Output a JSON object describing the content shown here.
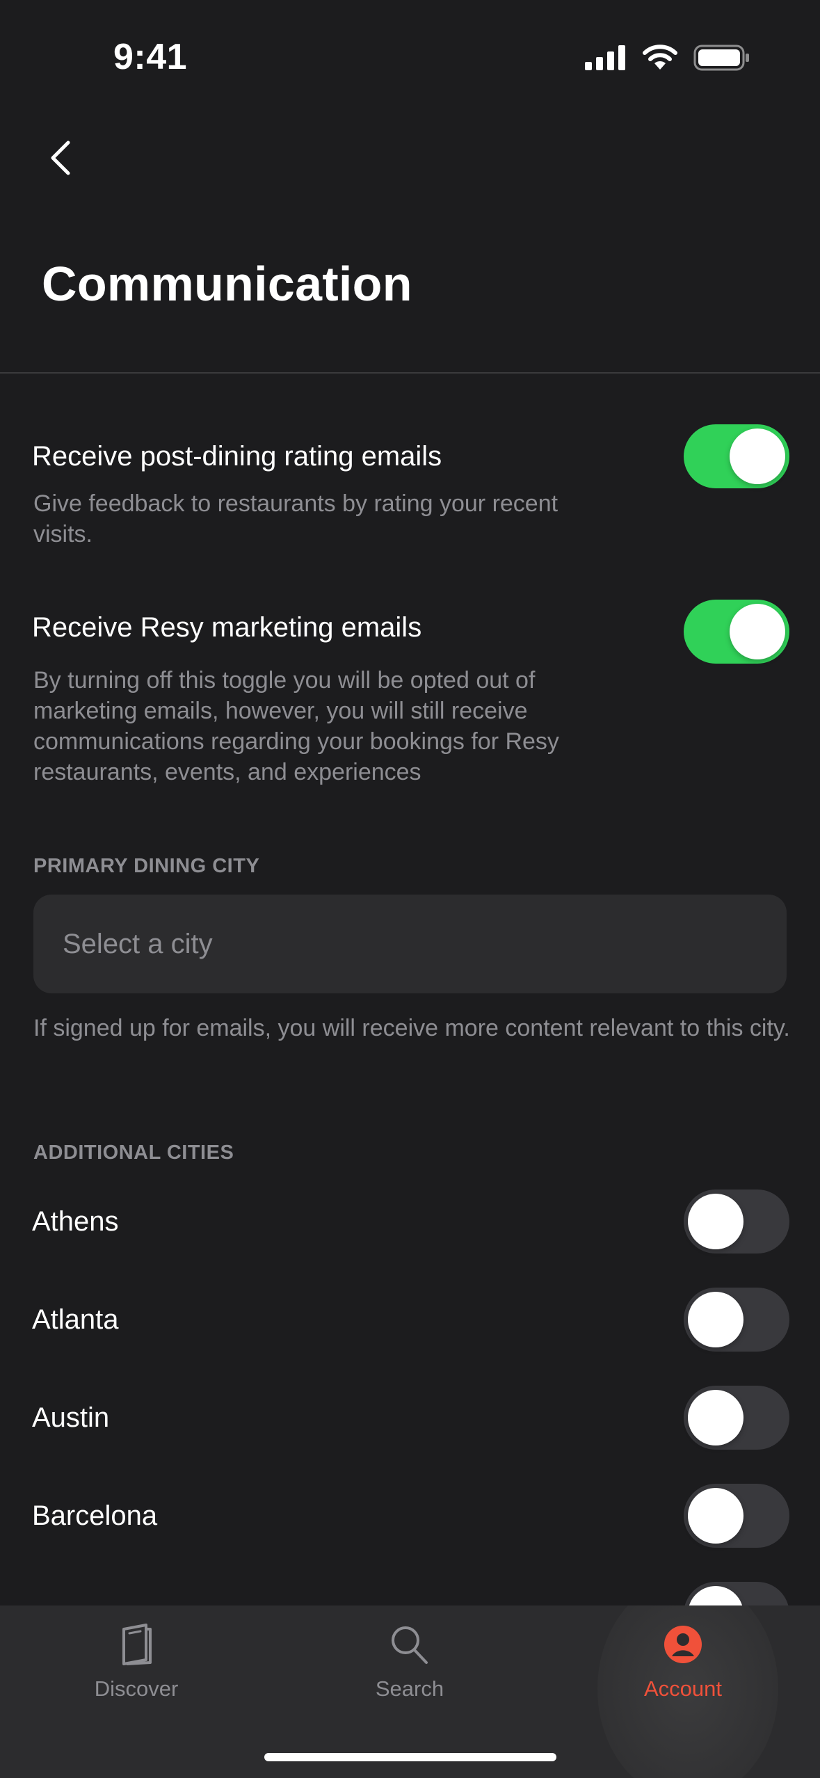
{
  "status_bar": {
    "time": "9:41"
  },
  "header": {
    "title": "Communication"
  },
  "settings": [
    {
      "title": "Receive post-dining rating emails",
      "description": "Give feedback to restaurants by rating your recent visits.",
      "enabled": true
    },
    {
      "title": "Receive Resy marketing emails",
      "description": "By turning off this toggle you will be opted out of marketing emails, however, you will still receive communications regarding your bookings for Resy restaurants, events, and experiences",
      "enabled": true
    }
  ],
  "primary_city": {
    "label": "PRIMARY DINING CITY",
    "placeholder": "Select a city",
    "help": "If signed up for emails, you will receive more content relevant to this city."
  },
  "additional_cities": {
    "label": "ADDITIONAL CITIES",
    "items": [
      {
        "name": "Athens",
        "enabled": false
      },
      {
        "name": "Atlanta",
        "enabled": false
      },
      {
        "name": "Austin",
        "enabled": false
      },
      {
        "name": "Barcelona",
        "enabled": false
      },
      {
        "name": "",
        "enabled": false
      }
    ]
  },
  "tab_bar": {
    "tabs": [
      {
        "label": "Discover",
        "icon": "discover-icon",
        "active": false
      },
      {
        "label": "Search",
        "icon": "search-icon",
        "active": false
      },
      {
        "label": "Account",
        "icon": "account-icon",
        "active": true
      }
    ]
  },
  "colors": {
    "background": "#1c1c1e",
    "toggle_on": "#30d158",
    "toggle_off": "#39393d",
    "accent": "#f0513a",
    "secondary_text": "#8e8e93"
  }
}
